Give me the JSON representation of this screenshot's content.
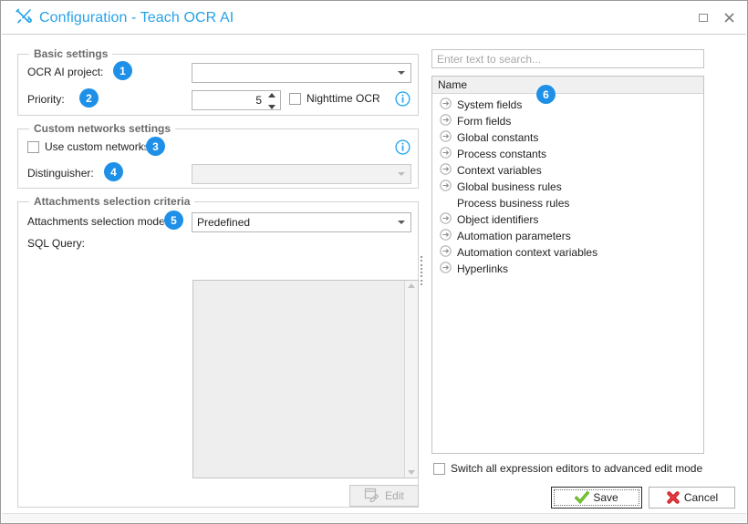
{
  "window": {
    "title": "Configuration - Teach OCR AI",
    "title_icon": "tools-icon",
    "maximize_label": "",
    "close_label": "✕",
    "accent_color": "#26a3e8",
    "badge_color": "#1e90e8"
  },
  "left": {
    "basic": {
      "group_title": "Basic settings",
      "project_label": "OCR AI project:",
      "project_value": "",
      "priority_label": "Priority:",
      "priority_value": "5",
      "nighttime_label": "Nighttime OCR",
      "nighttime_checked": false,
      "badge_project": "1",
      "badge_priority": "2"
    },
    "custom": {
      "group_title": "Custom networks settings",
      "use_custom_label": "Use custom networks",
      "use_custom_checked": false,
      "distinguisher_label": "Distinguisher:",
      "distinguisher_value": "",
      "badge_use_custom": "3",
      "badge_distinguisher": "4"
    },
    "attachments": {
      "group_title": "Attachments selection criteria",
      "mode_label": "Attachments selection mode:",
      "mode_value": "Predefined",
      "sql_label": "SQL Query:",
      "sql_value": "",
      "edit_label": "Edit",
      "badge_mode": "5"
    }
  },
  "right": {
    "search_placeholder": "Enter text to search...",
    "search_value": "",
    "tree_header": "Name",
    "badge_tree": "6",
    "tree_items": [
      {
        "label": "System fields",
        "has_icon": true
      },
      {
        "label": "Form fields",
        "has_icon": true
      },
      {
        "label": "Global constants",
        "has_icon": true
      },
      {
        "label": "Process constants",
        "has_icon": true
      },
      {
        "label": "Context variables",
        "has_icon": true
      },
      {
        "label": "Global business rules",
        "has_icon": true
      },
      {
        "label": "Process business rules",
        "has_icon": false
      },
      {
        "label": "Object identifiers",
        "has_icon": true
      },
      {
        "label": "Automation parameters",
        "has_icon": true
      },
      {
        "label": "Automation context variables",
        "has_icon": true
      },
      {
        "label": "Hyperlinks",
        "has_icon": true
      }
    ],
    "advanced_mode_label": "Switch all expression editors to advanced edit mode",
    "advanced_mode_checked": false,
    "save_label": "Save",
    "cancel_label": "Cancel"
  }
}
